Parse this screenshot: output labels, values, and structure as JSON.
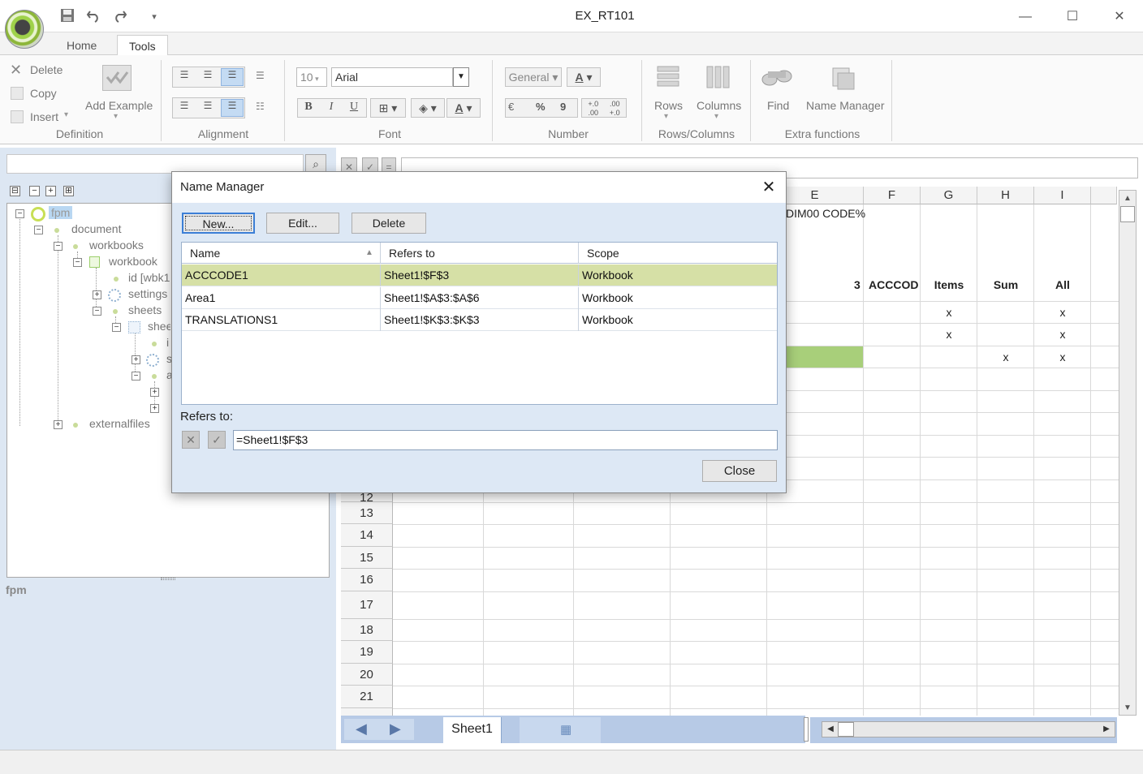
{
  "window": {
    "title": "EX_RT101",
    "minimize_glyph": "—",
    "maximize_glyph": "☐",
    "close_glyph": "✕"
  },
  "qat": {
    "save_icon": "save-icon",
    "undo_icon": "undo-icon",
    "redo_icon": "redo-icon",
    "customize_icon": "customize-icon"
  },
  "tabs": [
    {
      "label": "Home"
    },
    {
      "label": "Tools"
    }
  ],
  "ribbon": {
    "definition": {
      "label": "Definition",
      "delete": "Delete",
      "copy": "Copy",
      "insert": "Insert",
      "add_example": "Add Example"
    },
    "alignment": {
      "label": "Alignment"
    },
    "font": {
      "label": "Font",
      "size": "10",
      "family": "Arial",
      "bold": "B",
      "italic": "I",
      "underline": "U",
      "color_a": "A"
    },
    "number": {
      "label": "Number",
      "format": "General",
      "currency": "€",
      "percent": "%",
      "comma": "9",
      "inc_dec": "+.0 .00",
      "dec_dec": ".00 +.0"
    },
    "rows_columns": {
      "label": "Rows/Columns",
      "rows": "Rows",
      "columns": "Columns"
    },
    "extra": {
      "label": "Extra functions",
      "find": "Find",
      "name_manager": "Name Manager"
    }
  },
  "tree": {
    "nodes": [
      {
        "label": "fpm"
      },
      {
        "label": "document"
      },
      {
        "label": "workbooks"
      },
      {
        "label": "workbook"
      },
      {
        "label": "id [wbk1"
      },
      {
        "label": "settings"
      },
      {
        "label": "sheets"
      },
      {
        "label": "shee"
      },
      {
        "label": "i"
      },
      {
        "label": "s"
      },
      {
        "label": "a"
      },
      {
        "label": "externalfiles"
      }
    ],
    "selected_label": "fpm"
  },
  "sheet": {
    "columns": [
      "E",
      "F",
      "G",
      "H",
      "I"
    ],
    "rows": [
      "13",
      "14",
      "15",
      "16",
      "17",
      "18",
      "19",
      "20",
      "21"
    ],
    "partial_row": "12",
    "cells": {
      "e1": "DIM00  CODE%",
      "e4_num": "3",
      "e4": "ACCCOD",
      "g4": "Items",
      "h4": "Sum",
      "i4": "All",
      "g5": "x",
      "i5": "x",
      "g6": "x",
      "i6": "x",
      "h7": "x",
      "i7": "x"
    },
    "tab": "Sheet1"
  },
  "dialog": {
    "title": "Name Manager",
    "buttons": {
      "new": "New...",
      "edit": "Edit...",
      "delete": "Delete",
      "close": "Close"
    },
    "columns": {
      "name": "Name",
      "refers_to": "Refers to",
      "scope": "Scope"
    },
    "rows": [
      {
        "name": "ACCCODE1",
        "refers_to": "Sheet1!$F$3",
        "scope": "Workbook"
      },
      {
        "name": "Area1",
        "refers_to": "Sheet1!$A$3:$A$6",
        "scope": "Workbook"
      },
      {
        "name": "TRANSLATIONS1",
        "refers_to": "Sheet1!$K$3:$K$3",
        "scope": "Workbook"
      }
    ],
    "refers_label": "Refers to:",
    "refers_value": "=Sheet1!$F$3"
  },
  "colors": {
    "selected_row": "#d6e0a6",
    "highlight_cell": "#a8cf7a",
    "panel_bg": "#dde7f3",
    "dialog_bg": "#dde8f5"
  }
}
